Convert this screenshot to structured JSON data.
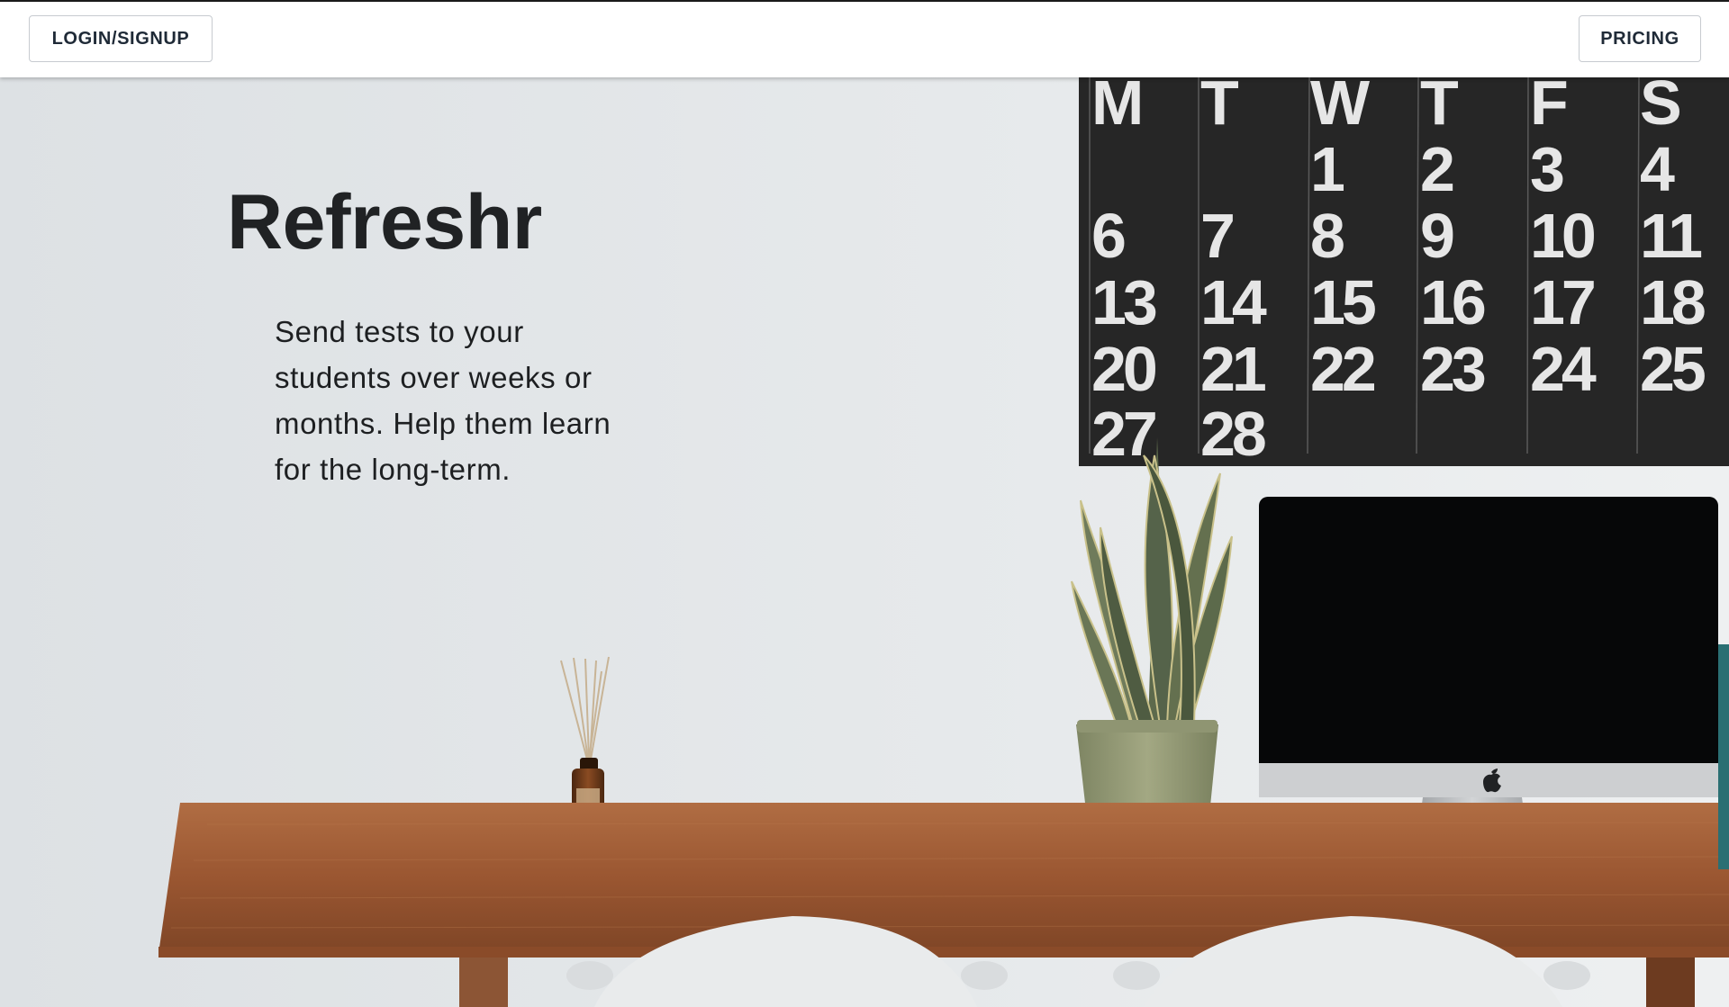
{
  "nav": {
    "login_label": "LOGIN/SIGNUP",
    "pricing_label": "PRICING"
  },
  "hero": {
    "title": "Refreshr",
    "tagline": "Send tests to your students over weeks or months. Help them learn for the long-term."
  },
  "calendar": {
    "weekdays": [
      "M",
      "T",
      "W",
      "T",
      "F",
      "S"
    ],
    "rows": [
      [
        "",
        "",
        "1",
        "2",
        "3",
        "4"
      ],
      [
        "6",
        "7",
        "8",
        "9",
        "10",
        "11"
      ],
      [
        "13",
        "14",
        "15",
        "16",
        "17",
        "18"
      ],
      [
        "20",
        "21",
        "22",
        "23",
        "24",
        "25"
      ],
      [
        "27",
        "28",
        "",
        "",
        "",
        ""
      ]
    ]
  },
  "icons": {
    "apple_logo": "apple-logo-icon"
  },
  "colors": {
    "nav_background": "#ffffff",
    "button_border": "#c7cbd0",
    "button_text": "#1f2a37",
    "wall": "#e3e6e8",
    "calendar_background": "#262626",
    "calendar_digits": "#e6e6e6",
    "desk_wood": "#9c5a34",
    "monitor_screen": "#060708",
    "title_text": "#202224"
  }
}
